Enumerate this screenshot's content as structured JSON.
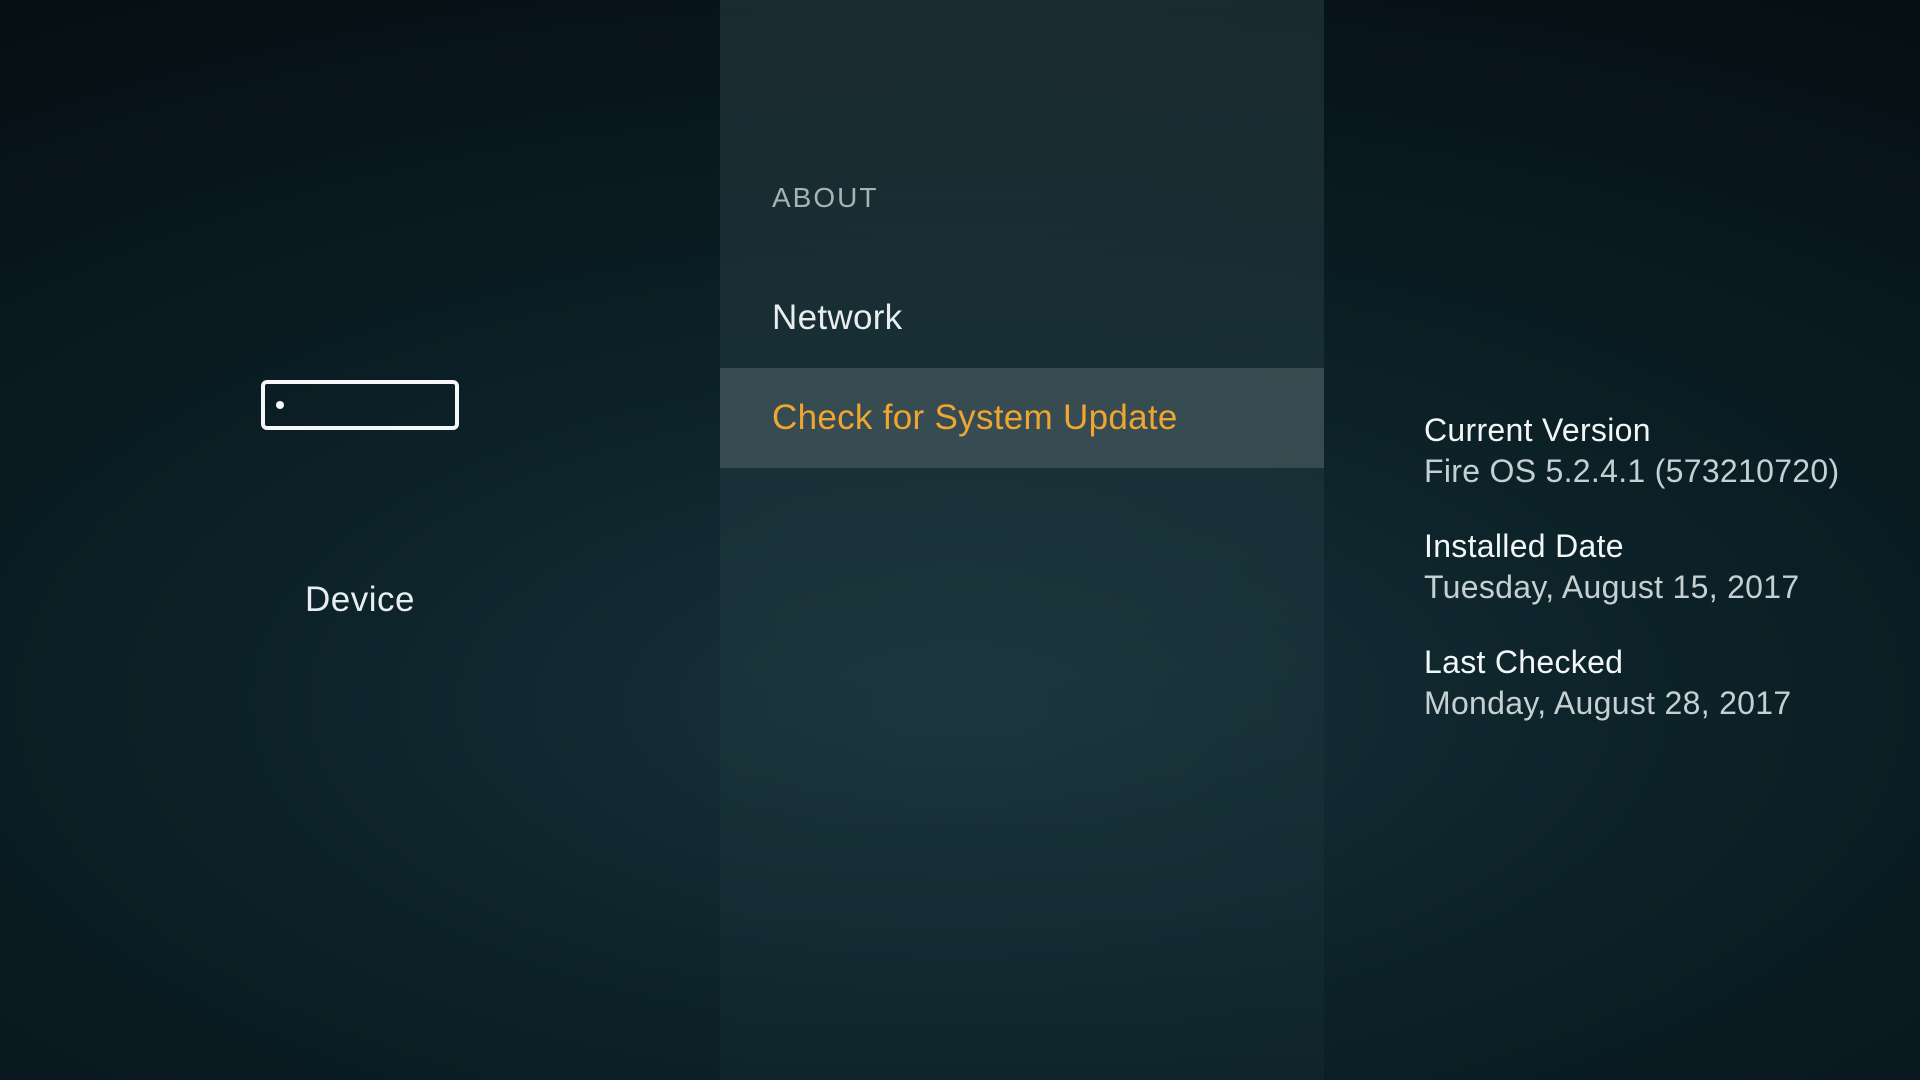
{
  "left": {
    "label": "Device"
  },
  "center": {
    "section": "ABOUT",
    "items": [
      {
        "label": "Network"
      },
      {
        "label": "Check for System Update"
      }
    ]
  },
  "right": {
    "current_version": {
      "title": "Current Version",
      "value": "Fire OS 5.2.4.1 (573210720)"
    },
    "installed_date": {
      "title": "Installed Date",
      "value": "Tuesday, August 15, 2017"
    },
    "last_checked": {
      "title": "Last Checked",
      "value": "Monday, August 28, 2017"
    }
  },
  "colors": {
    "accent": "#f0a530"
  }
}
